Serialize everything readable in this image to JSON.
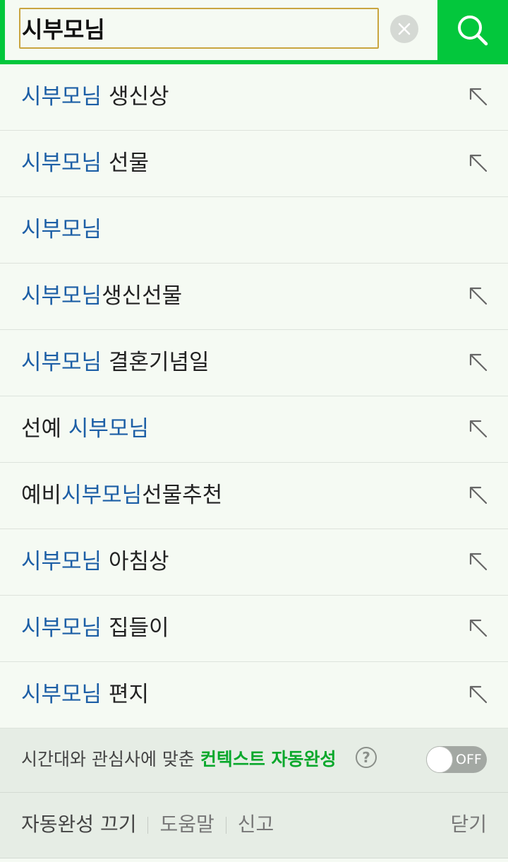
{
  "search": {
    "query": "시부모님"
  },
  "suggestions": [
    {
      "pre": "",
      "hl": "시부모님",
      "post": " 생신상",
      "arrow": true
    },
    {
      "pre": "",
      "hl": "시부모님",
      "post": " 선물",
      "arrow": true
    },
    {
      "pre": "",
      "hl": "시부모님",
      "post": "",
      "arrow": false
    },
    {
      "pre": "",
      "hl": "시부모님",
      "post": "생신선물",
      "arrow": true
    },
    {
      "pre": "",
      "hl": "시부모님",
      "post": " 결혼기념일",
      "arrow": true
    },
    {
      "pre": "선예 ",
      "hl": "시부모님",
      "post": "",
      "arrow": true
    },
    {
      "pre": "예비",
      "hl": "시부모님",
      "post": "선물추천",
      "arrow": true
    },
    {
      "pre": "",
      "hl": "시부모님",
      "post": " 아침상",
      "arrow": true
    },
    {
      "pre": "",
      "hl": "시부모님",
      "post": " 집들이",
      "arrow": true
    },
    {
      "pre": "",
      "hl": "시부모님",
      "post": " 편지",
      "arrow": true
    }
  ],
  "context": {
    "text_plain": "시간대와 관심사에 맞춘 ",
    "text_highlight": "컨텍스트 자동완성",
    "help_symbol": "?",
    "toggle_label": "OFF"
  },
  "footer": {
    "disable_label": "자동완성 끄기",
    "help_label": "도움말",
    "report_label": "신고",
    "close_label": "닫기"
  },
  "colors": {
    "brand_green": "#03c73c",
    "highlight_blue": "#1d5fa6",
    "context_green": "#0aa82c"
  },
  "icons": {
    "search": "search-icon",
    "clear": "clear-icon",
    "arrow": "arrow-up-left-icon",
    "help": "help-icon"
  }
}
